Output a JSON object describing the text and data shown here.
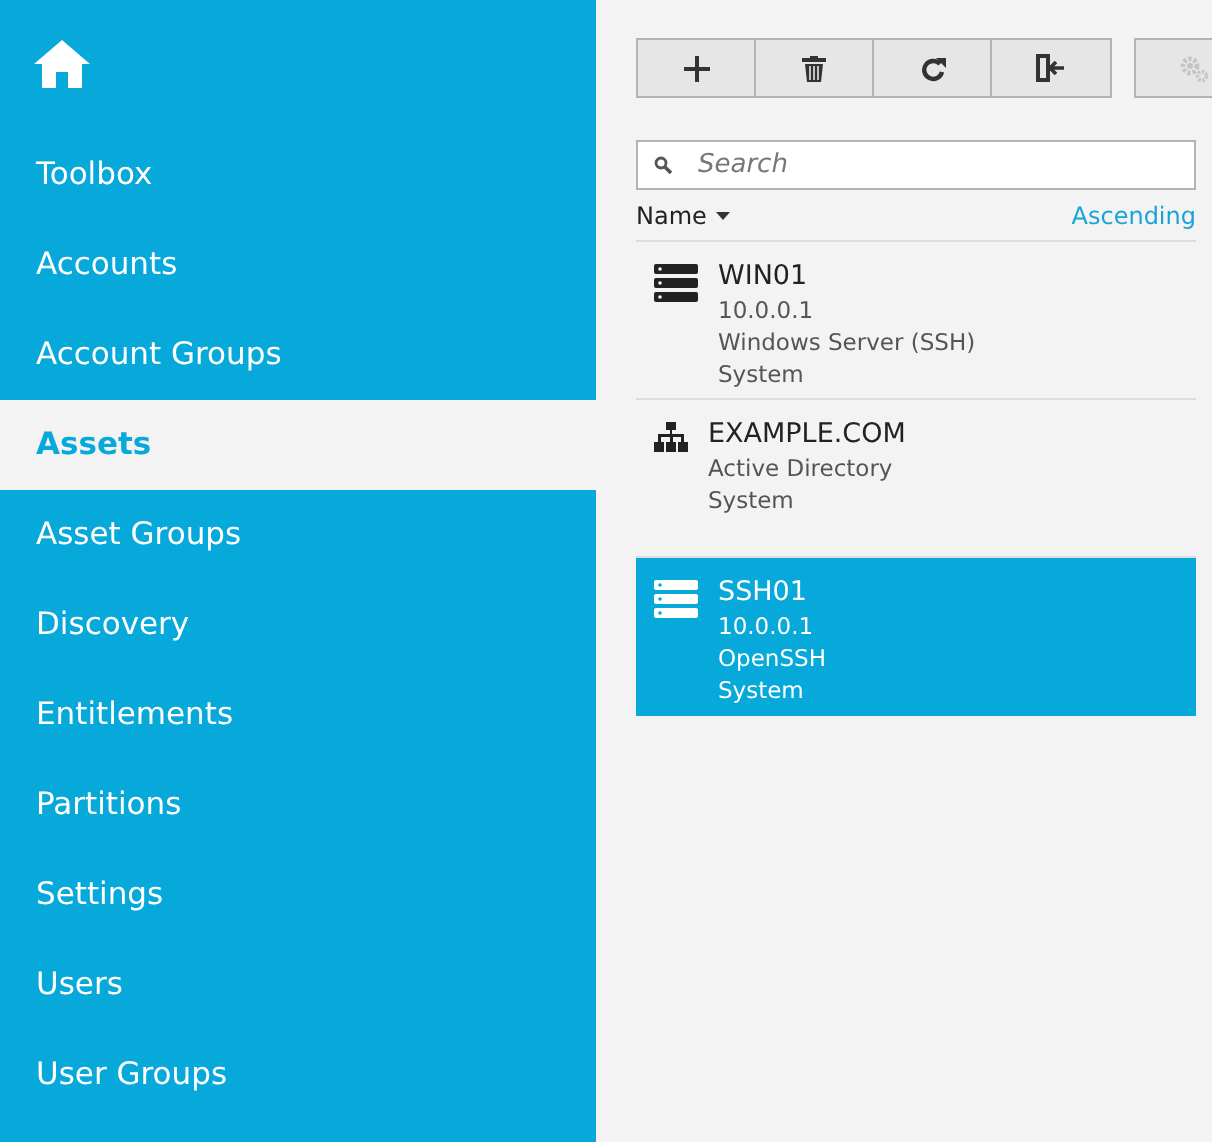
{
  "sidebar": {
    "items": [
      {
        "label": "Toolbox",
        "selected": false
      },
      {
        "label": "Accounts",
        "selected": false
      },
      {
        "label": "Account Groups",
        "selected": false
      },
      {
        "label": "Assets",
        "selected": true
      },
      {
        "label": "Asset Groups",
        "selected": false
      },
      {
        "label": "Discovery",
        "selected": false
      },
      {
        "label": "Entitlements",
        "selected": false
      },
      {
        "label": "Partitions",
        "selected": false
      },
      {
        "label": "Settings",
        "selected": false
      },
      {
        "label": "Users",
        "selected": false
      },
      {
        "label": "User Groups",
        "selected": false
      }
    ]
  },
  "toolbar": {
    "buttons": [
      {
        "kind": "add",
        "disabled": false
      },
      {
        "kind": "delete",
        "disabled": false
      },
      {
        "kind": "refresh",
        "disabled": false
      },
      {
        "kind": "import",
        "disabled": false
      }
    ],
    "extra_buttons": [
      {
        "kind": "settings",
        "disabled": true
      }
    ]
  },
  "search": {
    "placeholder": "Search"
  },
  "sort": {
    "field": "Name",
    "order": "Ascending"
  },
  "assets": [
    {
      "kind": "server",
      "name": "WIN01",
      "lines": [
        "10.0.0.1",
        "Windows Server (SSH)",
        "System"
      ],
      "selected": false
    },
    {
      "kind": "directory",
      "name": "EXAMPLE.COM",
      "lines": [
        "Active Directory",
        "System"
      ],
      "selected": false
    },
    {
      "kind": "server",
      "name": "SSH01",
      "lines": [
        "10.0.0.1",
        "OpenSSH",
        "System"
      ],
      "selected": true
    }
  ]
}
